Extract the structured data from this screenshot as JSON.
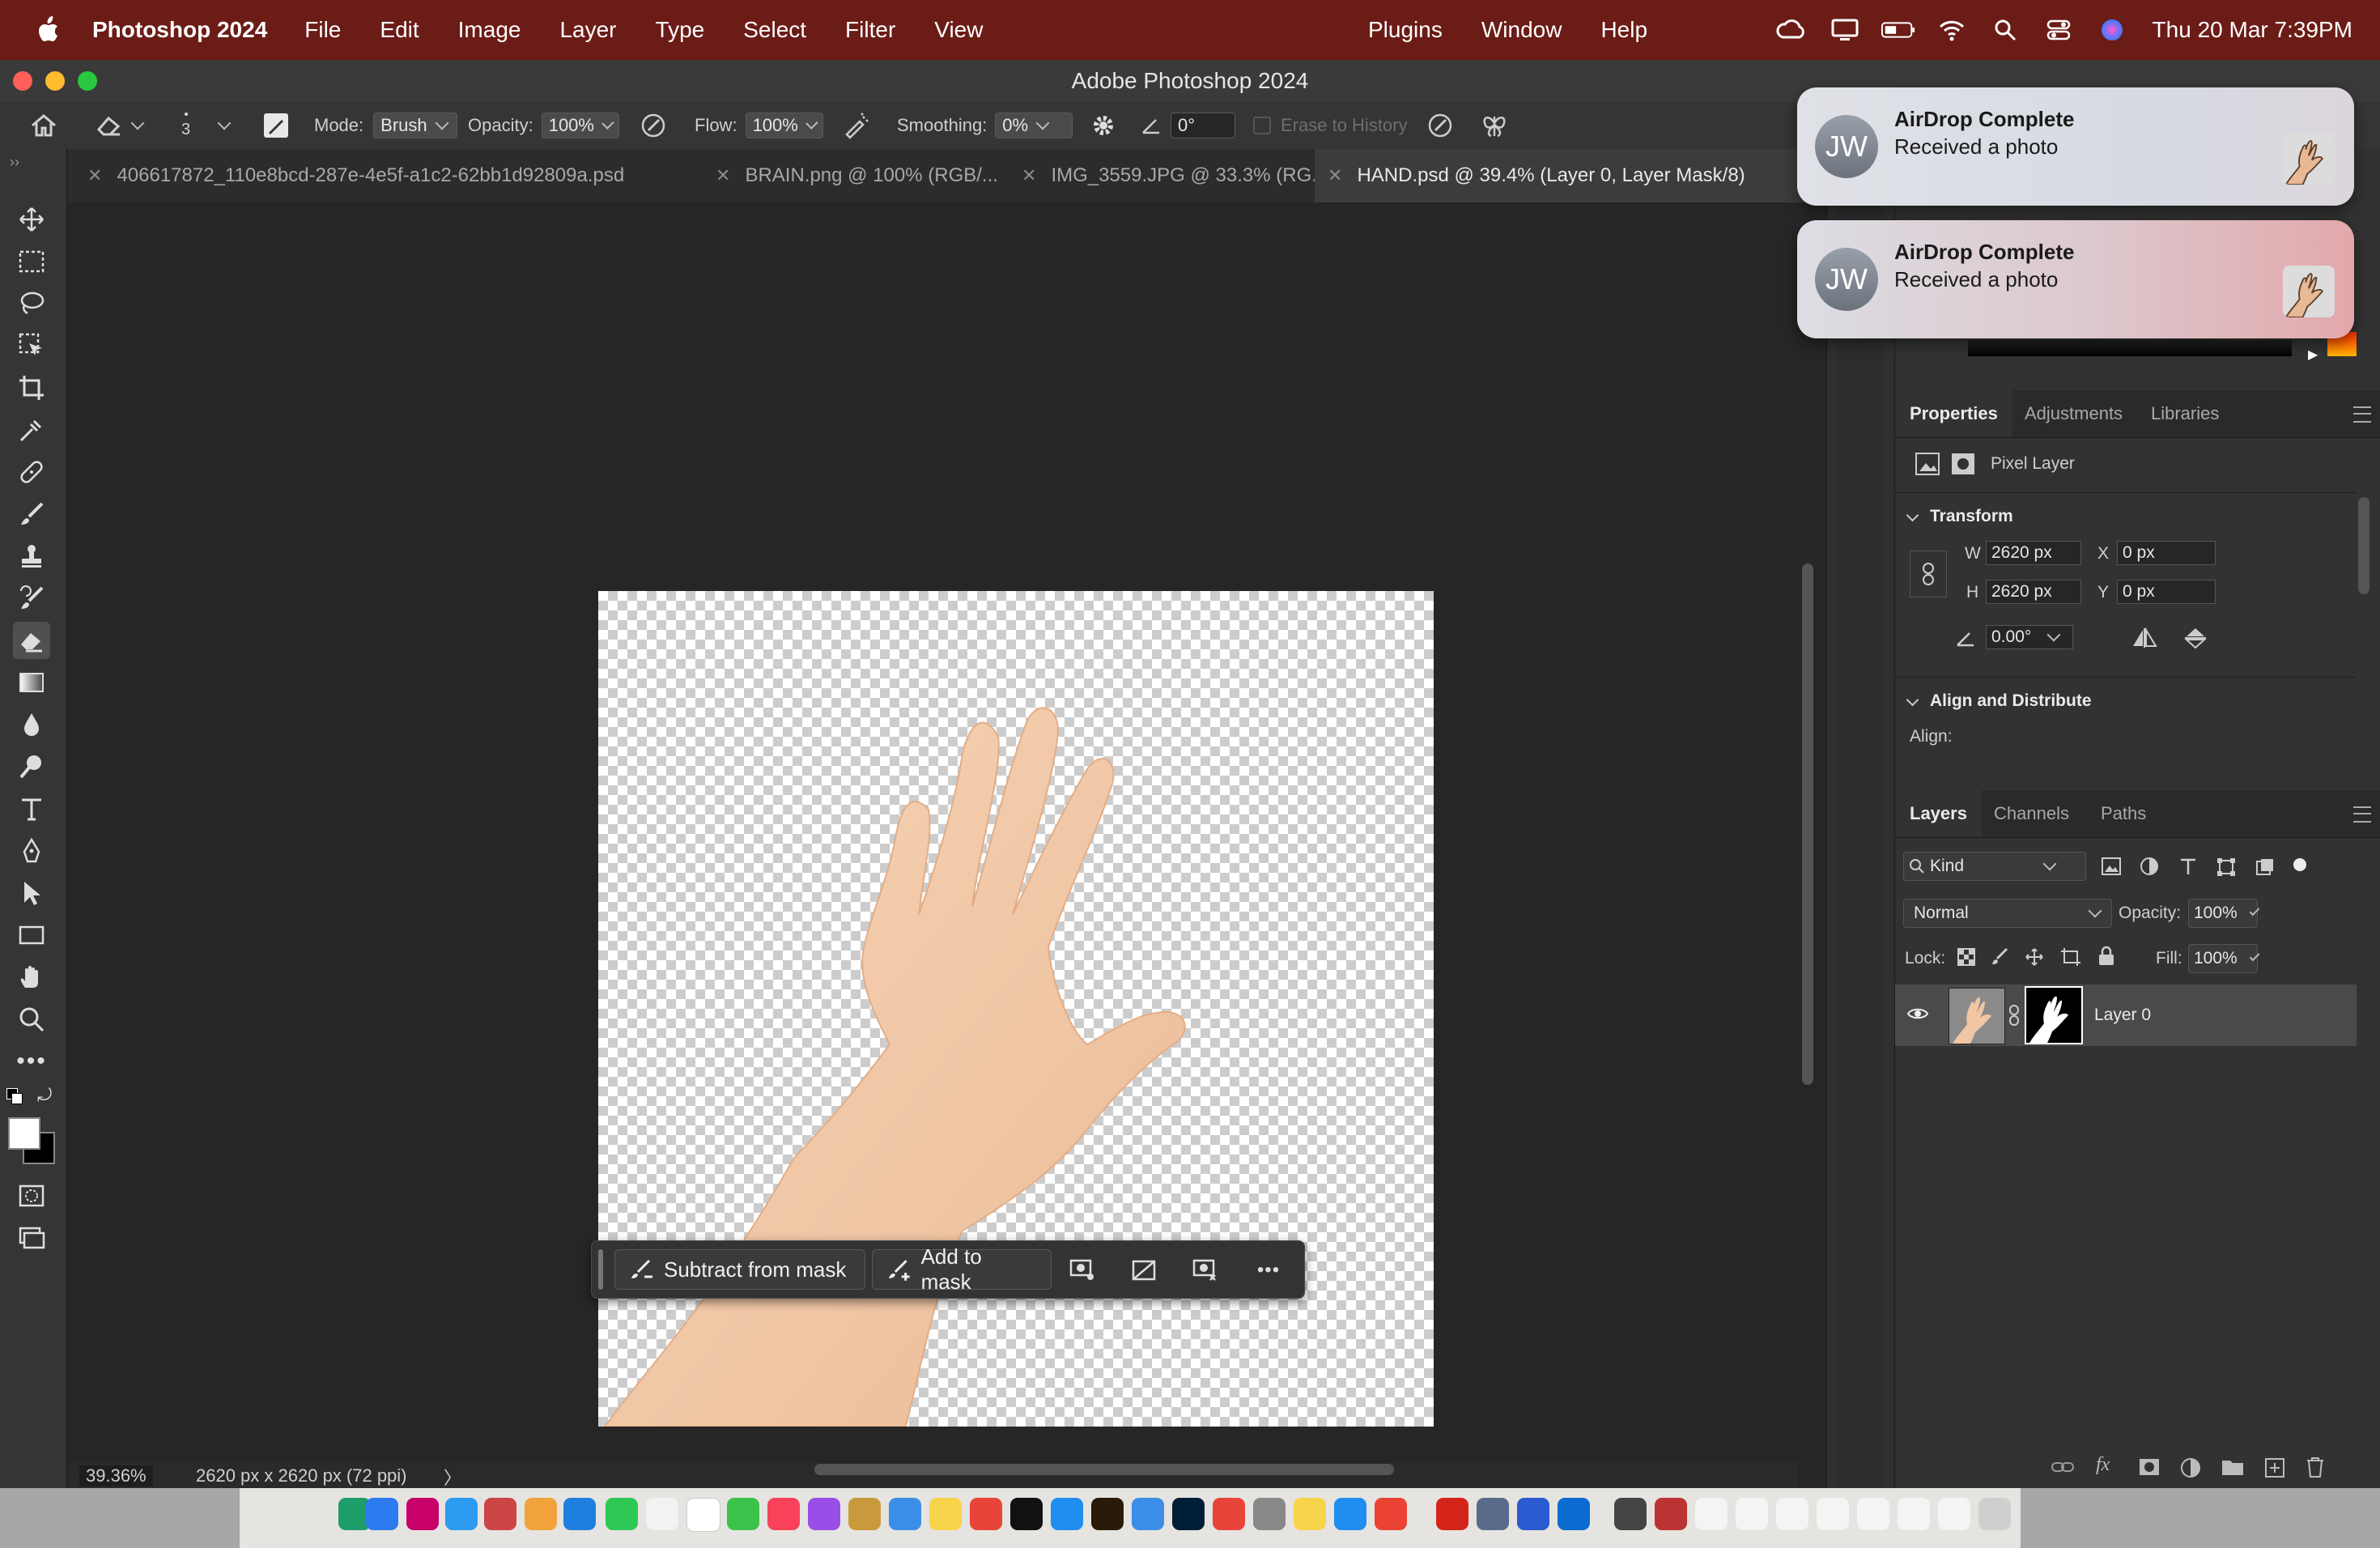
{
  "menubar": {
    "app_name": "Photoshop 2024",
    "items": [
      "File",
      "Edit",
      "Image",
      "Layer",
      "Type",
      "Select",
      "Filter",
      "View"
    ],
    "right_items": [
      "Plugins",
      "Window",
      "Help"
    ],
    "clock": "Thu 20 Mar  7:39PM"
  },
  "window": {
    "title": "Adobe Photoshop 2024"
  },
  "options": {
    "brush_size": "3",
    "mode_label": "Mode:",
    "mode_value": "Brush",
    "opacity_label": "Opacity:",
    "opacity_value": "100%",
    "flow_label": "Flow:",
    "flow_value": "100%",
    "smoothing_label": "Smoothing:",
    "smoothing_value": "0%",
    "angle_value": "0°",
    "erase_history_label": "Erase to History"
  },
  "tabs": [
    {
      "label": "406617872_110e8bcd-287e-4e5f-a1c2-62bb1d92809a.psd"
    },
    {
      "label": "BRAIN.png @ 100% (RGB/..."
    },
    {
      "label": "IMG_3559.JPG @ 33.3% (RG..."
    },
    {
      "label": "HAND.psd @ 39.4% (Layer 0, Layer Mask/8)"
    }
  ],
  "context_bar": {
    "subtract_label": "Subtract from mask",
    "add_label": "Add to mask"
  },
  "status": {
    "zoom": "39.36%",
    "dimensions": "2620 px x 2620 px (72 ppi)",
    "arrow": "〉"
  },
  "notifications": [
    {
      "avatar": "JW",
      "title": "AirDrop Complete",
      "body": "Received a photo"
    },
    {
      "avatar": "JW",
      "title": "AirDrop Complete",
      "body": "Received a photo"
    }
  ],
  "properties": {
    "tabs": [
      "Properties",
      "Adjustments",
      "Libraries"
    ],
    "layer_type": "Pixel Layer",
    "transform_label": "Transform",
    "w_label": "W",
    "w_value": "2620 px",
    "x_label": "X",
    "x_value": "0 px",
    "h_label": "H",
    "h_value": "2620 px",
    "y_label": "Y",
    "y_value": "0 px",
    "angle_value": "0.00°",
    "align_section": "Align and Distribute",
    "align_label": "Align:"
  },
  "layers": {
    "tabs": [
      "Layers",
      "Channels",
      "Paths"
    ],
    "filter_kind": "Kind",
    "blend_mode": "Normal",
    "opacity_label": "Opacity:",
    "opacity_value": "100%",
    "lock_label": "Lock:",
    "fill_label": "Fill:",
    "fill_value": "100%",
    "items": [
      {
        "name": "Layer 0"
      }
    ]
  },
  "colors": {
    "menubar": "#6b1c17",
    "panel_bg": "#323232",
    "canvas_bg": "#262626",
    "skin": "#f2c9a6"
  }
}
